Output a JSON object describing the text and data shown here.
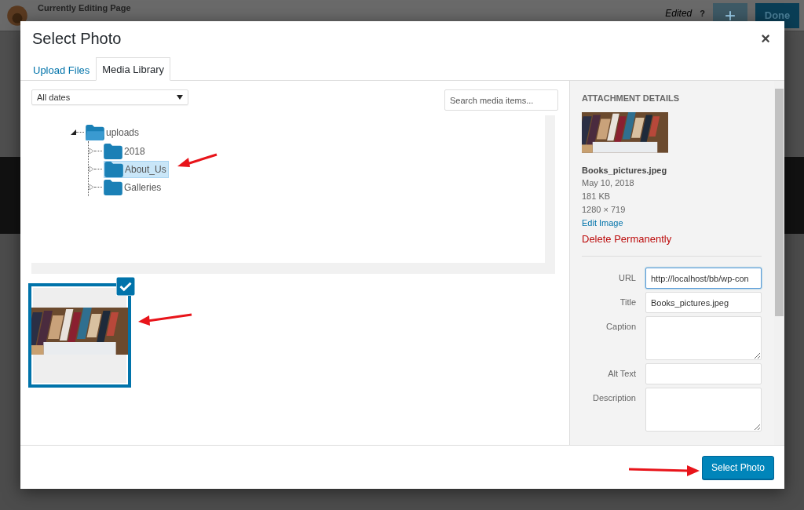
{
  "background": {
    "page_label": "Currently Editing Page",
    "status": "Edited",
    "help": "?",
    "add": "+",
    "done_button": "Done"
  },
  "modal": {
    "title": "Select Photo",
    "close": "×"
  },
  "tabs": [
    {
      "label": "Upload Files",
      "selected": false
    },
    {
      "label": "Media Library",
      "selected": true
    }
  ],
  "filter": {
    "value": "All dates"
  },
  "search": {
    "placeholder": "Search media items..."
  },
  "folders": [
    {
      "name": "uploads",
      "expanded": true,
      "selected": false,
      "children": [
        {
          "name": "2018",
          "expanded": false,
          "selected": false
        },
        {
          "name": "About_Us",
          "expanded": false,
          "selected": true
        },
        {
          "name": "Galleries",
          "expanded": false,
          "selected": false
        }
      ]
    }
  ],
  "media": [
    {
      "kind": "picture",
      "selected": true
    }
  ],
  "details": {
    "heading": "ATTACHMENT DETAILS",
    "filename": "Books_pictures.jpeg",
    "date": "May 10, 2018",
    "size": "181 KB",
    "dimensions": "1280 × 719",
    "edit_link": "Edit Image",
    "delete_link": "Delete Permanently"
  },
  "fields": [
    {
      "label": "URL",
      "value": "http://localhost/bb/wp-con",
      "kind": "input"
    },
    {
      "label": "Title",
      "value": "Books_pictures.jpeg",
      "kind": "input"
    },
    {
      "label": "Caption",
      "kind": "textarea"
    },
    {
      "label": "Alt Text",
      "kind": "input"
    },
    {
      "label": "Description",
      "kind": "textarea"
    }
  ],
  "select_button": "Select Photo"
}
